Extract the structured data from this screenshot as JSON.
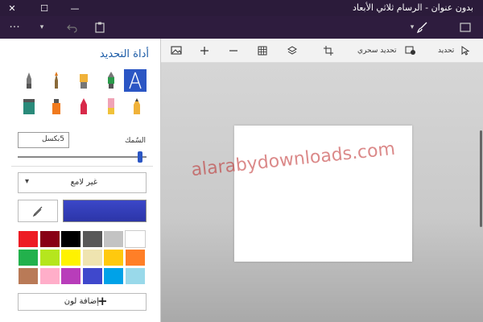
{
  "window": {
    "title": "بدون عنوان - الرسام ثلاثي الأبعاد",
    "close_glyph": "✕",
    "maximize_glyph": "☐",
    "minimize_glyph": "—"
  },
  "toolbar": {
    "more_glyph": "···",
    "dropdown_glyph": "▾"
  },
  "panel": {
    "title": "أداة التحديد",
    "thickness_label": "السُمك",
    "thickness_value": "5بكسل",
    "thickness_level": 0.95,
    "finish_label": "غير لامع",
    "add_color_label": "إضافة لون",
    "add_color_glyph": "+",
    "palette": [
      [
        "#ed1c24",
        "#880015",
        "#000000",
        "#585858",
        "#c3c3c3",
        "#ffffff"
      ],
      [
        "#22b14c",
        "#b5e61d",
        "#fff200",
        "#efe4b0",
        "#ffc90e",
        "#ff7f27"
      ],
      [
        "#b97a57",
        "#ffaec9",
        "#b83dba",
        "#3f48cc",
        "#00a2e8",
        "#99d9ea"
      ]
    ],
    "selected_color": "#3b47c8"
  },
  "canvas_toolbar": {
    "select_label": "تحديد",
    "magic_select_label": "تحديد سحري"
  },
  "watermark": "alarabydownloads.com"
}
